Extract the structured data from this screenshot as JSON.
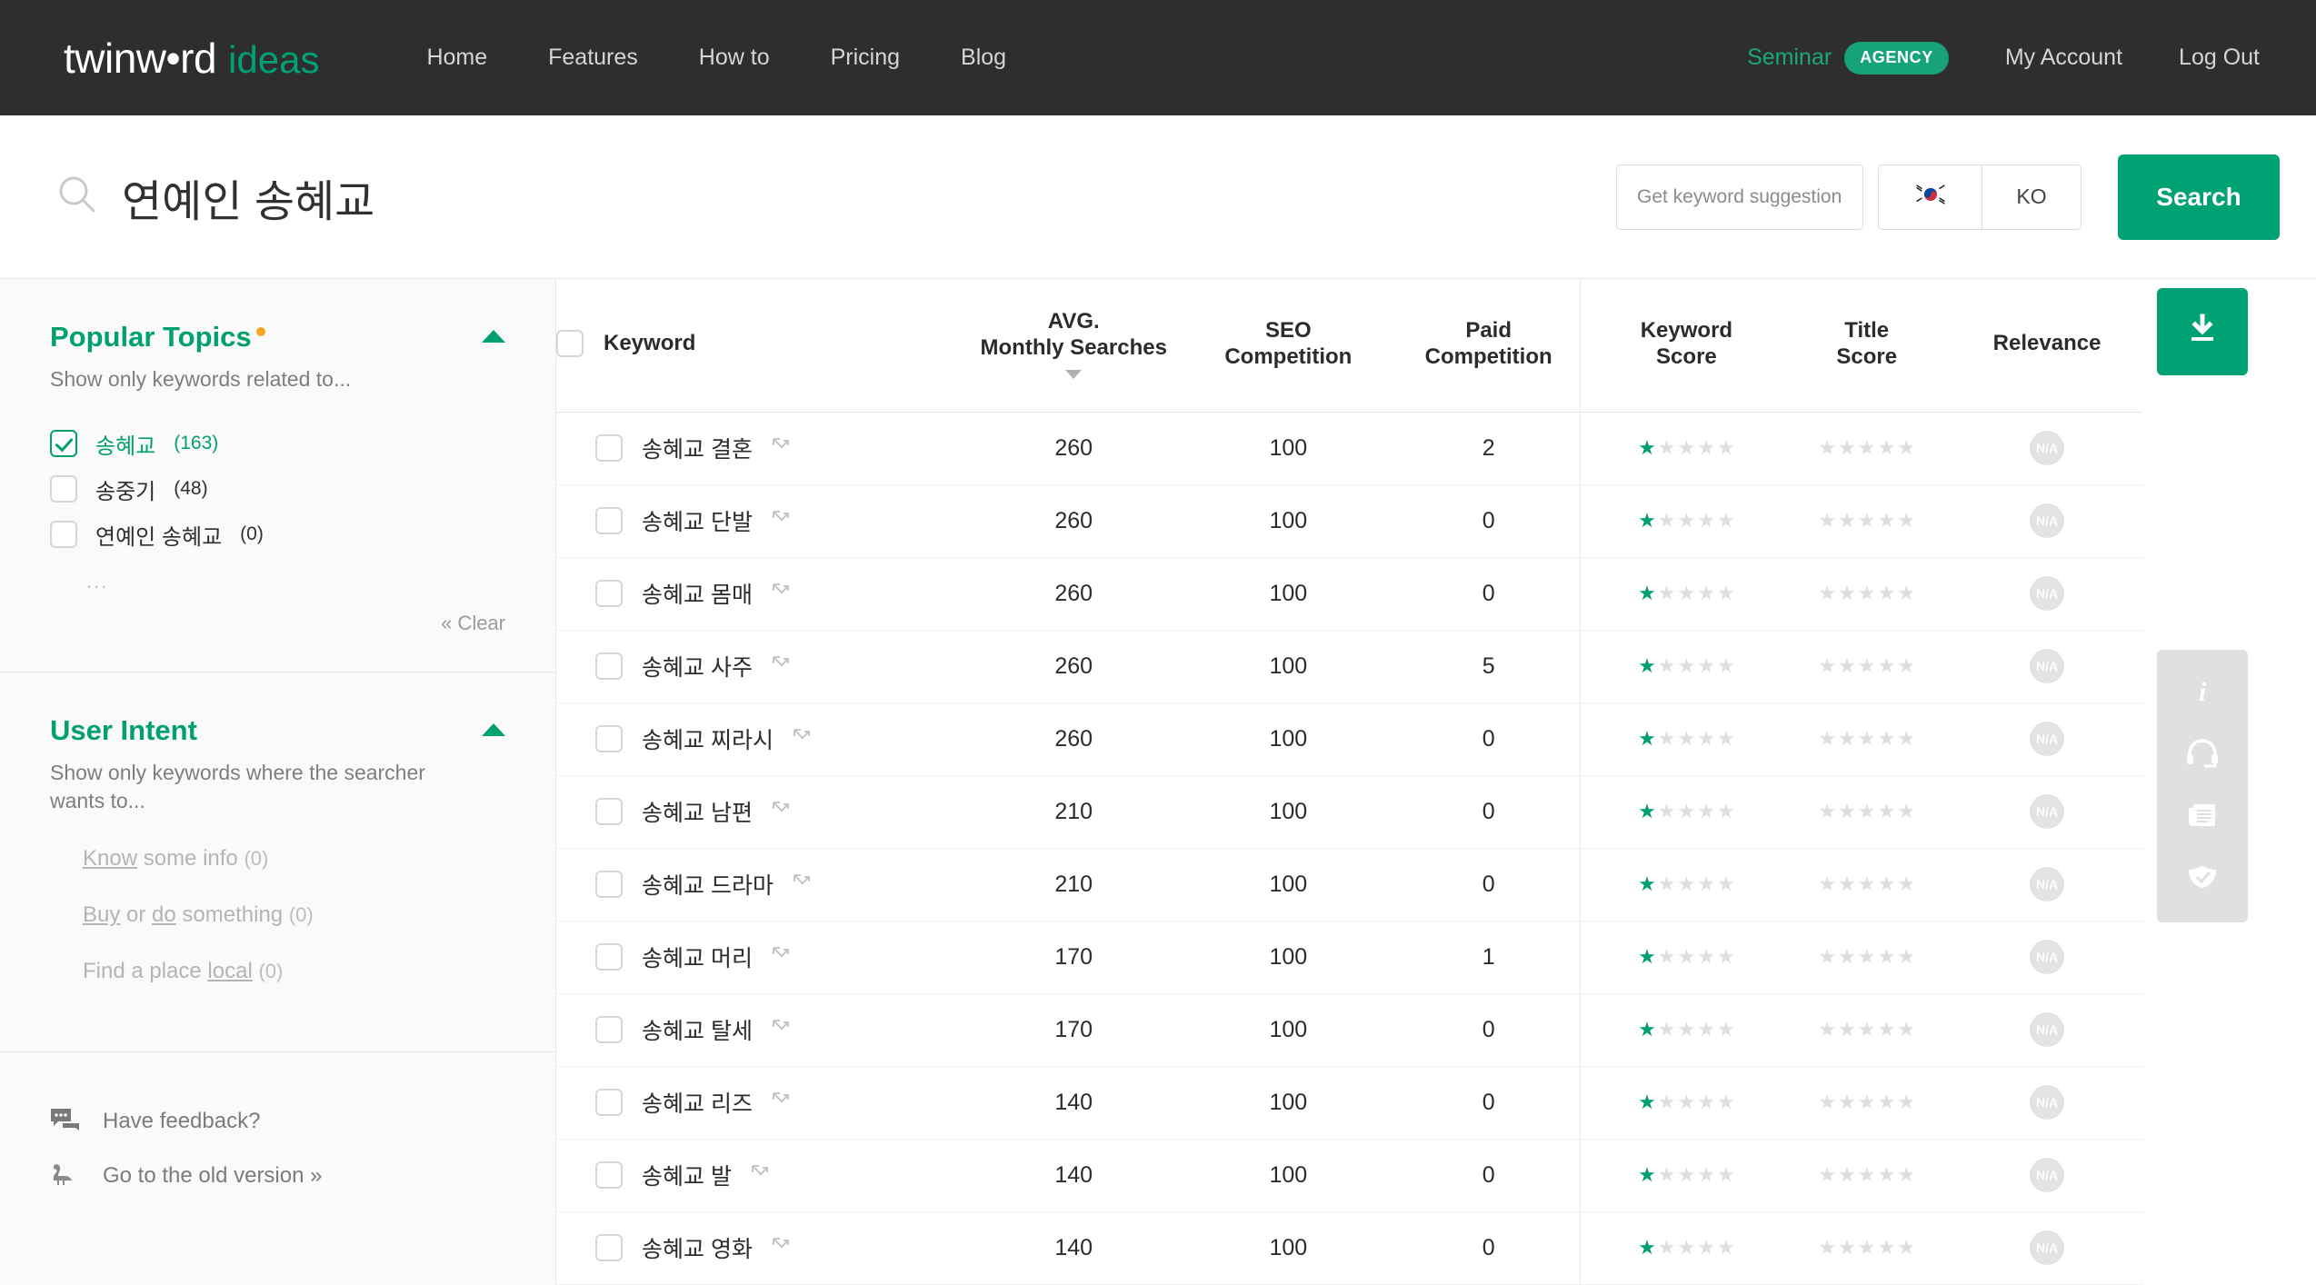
{
  "brand": {
    "name_main": "twinw•rd",
    "name_sub": "ideas"
  },
  "nav": {
    "links": [
      "Home",
      "Features",
      "How to",
      "Pricing",
      "Blog"
    ],
    "seminar_label": "Seminar",
    "plan_badge": "AGENCY",
    "my_account": "My Account",
    "log_out": "Log Out"
  },
  "search": {
    "query": "연예인 송혜교",
    "suggest_placeholder": "Get keyword suggestions",
    "suggest_value": "",
    "locale_flag": "kr-flag",
    "locale_lang": "KO",
    "search_button": "Search"
  },
  "sidebar": {
    "popular_topics": {
      "title": "Popular Topics",
      "subtitle": "Show only keywords related to...",
      "options": [
        {
          "label": "송혜교",
          "count": "(163)",
          "checked": true
        },
        {
          "label": "송중기",
          "count": "(48)",
          "checked": false
        },
        {
          "label": "연예인 송혜교",
          "count": "(0)",
          "checked": false
        }
      ],
      "more": "...",
      "clear": "« Clear"
    },
    "user_intent": {
      "title": "User Intent",
      "subtitle": "Show only keywords where the searcher wants to...",
      "options": [
        {
          "pre": "",
          "link": "Know",
          "post": " some info",
          "count": "(0)"
        },
        {
          "pre": "",
          "link": "Buy",
          "post": " or do something",
          "count": "(0)"
        },
        {
          "pre": "Find a place ",
          "link": "local",
          "post": "",
          "count": "(0)"
        }
      ]
    },
    "footer": [
      {
        "label": "Have feedback?",
        "icon": "chat-bubble-icon"
      },
      {
        "label": "Go to the old version »",
        "icon": "dinosaur-icon"
      }
    ]
  },
  "table": {
    "columns": [
      {
        "key": "keyword",
        "label": "Keyword"
      },
      {
        "key": "avg",
        "label_top": "AVG.",
        "label_bottom": "Monthly Searches",
        "sorted": "desc"
      },
      {
        "key": "seo",
        "label_top": "SEO",
        "label_bottom": "Competition"
      },
      {
        "key": "paid",
        "label_top": "Paid",
        "label_bottom": "Competition"
      },
      {
        "key": "kscore",
        "label_top": "Keyword",
        "label_bottom": "Score"
      },
      {
        "key": "tscore",
        "label_top": "Title",
        "label_bottom": "Score"
      },
      {
        "key": "relevance",
        "label": "Relevance"
      }
    ],
    "rows": [
      {
        "keyword": "송혜교 결혼",
        "avg": "260",
        "seo": "100",
        "paid": "2",
        "kscore": 1,
        "tscore": 0,
        "relevance": "N/A",
        "checked": false
      },
      {
        "keyword": "송혜교 단발",
        "avg": "260",
        "seo": "100",
        "paid": "0",
        "kscore": 1,
        "tscore": 0,
        "relevance": "N/A",
        "checked": false
      },
      {
        "keyword": "송혜교 몸매",
        "avg": "260",
        "seo": "100",
        "paid": "0",
        "kscore": 1,
        "tscore": 0,
        "relevance": "N/A",
        "checked": false
      },
      {
        "keyword": "송혜교 사주",
        "avg": "260",
        "seo": "100",
        "paid": "5",
        "kscore": 1,
        "tscore": 0,
        "relevance": "N/A",
        "checked": false
      },
      {
        "keyword": "송혜교 찌라시",
        "avg": "260",
        "seo": "100",
        "paid": "0",
        "kscore": 1,
        "tscore": 0,
        "relevance": "N/A",
        "checked": false
      },
      {
        "keyword": "송혜교 남편",
        "avg": "210",
        "seo": "100",
        "paid": "0",
        "kscore": 1,
        "tscore": 0,
        "relevance": "N/A",
        "checked": false
      },
      {
        "keyword": "송혜교 드라마",
        "avg": "210",
        "seo": "100",
        "paid": "0",
        "kscore": 1,
        "tscore": 0,
        "relevance": "N/A",
        "checked": false
      },
      {
        "keyword": "송혜교 머리",
        "avg": "170",
        "seo": "100",
        "paid": "1",
        "kscore": 1,
        "tscore": 0,
        "relevance": "N/A",
        "checked": false
      },
      {
        "keyword": "송혜교 탈세",
        "avg": "170",
        "seo": "100",
        "paid": "0",
        "kscore": 1,
        "tscore": 0,
        "relevance": "N/A",
        "checked": false
      },
      {
        "keyword": "송혜교 리즈",
        "avg": "140",
        "seo": "100",
        "paid": "0",
        "kscore": 1,
        "tscore": 0,
        "relevance": "N/A",
        "checked": false
      },
      {
        "keyword": "송혜교 발",
        "avg": "140",
        "seo": "100",
        "paid": "0",
        "kscore": 1,
        "tscore": 0,
        "relevance": "N/A",
        "checked": false
      },
      {
        "keyword": "송혜교 영화",
        "avg": "140",
        "seo": "100",
        "paid": "0",
        "kscore": 1,
        "tscore": 0,
        "relevance": "N/A",
        "checked": false
      }
    ],
    "select_all_checked": false,
    "star_max": 5
  },
  "rail": {
    "download": "download-icon",
    "buttons": [
      "info-icon",
      "headset-icon",
      "news-icon",
      "shield-check-icon"
    ]
  },
  "colors": {
    "brand_green": "#00a173",
    "nav_bg": "#2e2e2e",
    "accent_orange": "#f5a623",
    "star_on": "#00a070",
    "star_off": "#dedede"
  }
}
